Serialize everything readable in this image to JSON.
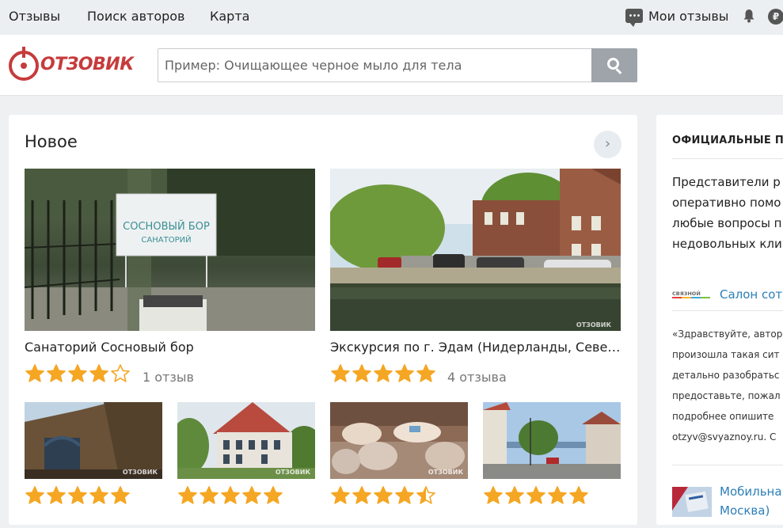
{
  "topnav": {
    "links": [
      "Отзывы",
      "Поиск авторов",
      "Карта"
    ],
    "my_reviews": "Мои отзывы",
    "ruble": "₽"
  },
  "header": {
    "logo_text": "ОТЗОВИК",
    "search_placeholder": "Пример: Очищающее черное мыло для тела"
  },
  "main": {
    "title": "Новое",
    "next_arrow": "›",
    "featured": [
      {
        "title": "Санаторий Сосновый бор",
        "rating": 4,
        "reviews": "1 отзыв",
        "sign_line1": "СОСНОВЫЙ БОР",
        "sign_line2": "САНАТОРИЙ"
      },
      {
        "title": "Экскурсия по г. Эдам (Нидерланды, Север...",
        "rating": 5,
        "reviews": "4 отзыва"
      }
    ],
    "small": [
      {
        "rating": 5
      },
      {
        "rating": 5
      },
      {
        "rating": 4.5
      },
      {
        "rating": 5
      }
    ],
    "watermark": "ОТЗОВИК"
  },
  "side": {
    "title": "ОФИЦИАЛЬНЫЕ П",
    "text_lines": [
      "Представители р",
      "оперативно помо",
      "любые вопросы п",
      "недовольных кли"
    ],
    "brand_logo": "СВЯЗНОЙ",
    "brand_link": "Салон сот",
    "quote_lines": [
      "«Здравствуйте, автор",
      "произошла такая сит",
      "детально разобратьс",
      "предоставьте, пожал",
      "подробнее опишите",
      "otzyv@svyaznoy.ru. С"
    ],
    "mobile_link_lines": [
      "Мобильна",
      "Москва)"
    ]
  },
  "colors": {
    "brand": "#c63b3c",
    "star": "#f5a623",
    "link": "#2d7fb8"
  }
}
